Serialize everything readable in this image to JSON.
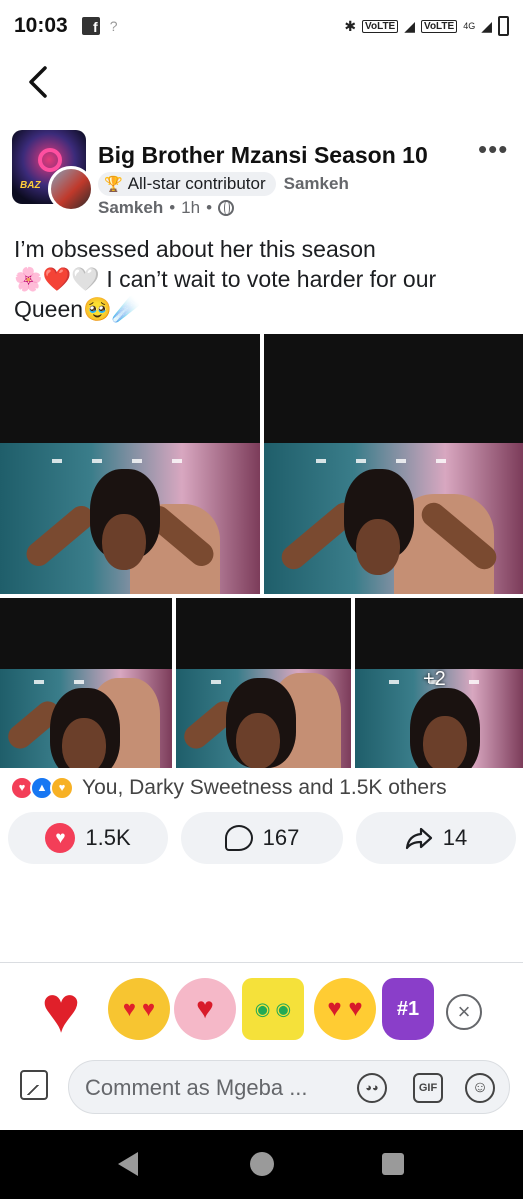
{
  "status_bar": {
    "time": "10:03",
    "fb_icon": "f",
    "signal_text": "?",
    "volte1": "VoLTE",
    "volte2": "VoLTE",
    "network": "4G"
  },
  "nav": {
    "back_icon": "‹"
  },
  "post": {
    "group_name": "Big Brother Mzansi Season 10",
    "badge_label": "All-star contributor",
    "badge_author": "Samkeh",
    "author": "Samkeh",
    "time_ago": "1h",
    "separator": "•",
    "more_icon": "•••",
    "text_line1": "I’m obsessed about her this season",
    "text_line2_emojis": "🌸❤️🤍",
    "text_line2": "I can’t wait to vote harder for our",
    "text_line3": "Queen",
    "text_line3_emojis": "🥹☄️",
    "more_photos": "+2"
  },
  "reactions": {
    "summary": "You, Darky Sweetness and 1.5K others"
  },
  "actions": {
    "reactions_count": "1.5K",
    "comments_count": "167",
    "shares_count": "14"
  },
  "stickers": {
    "heart": "♥",
    "cat": "♥ ♥",
    "girl": "♥",
    "sponge": "◉ ◉",
    "face": "♥ ♥",
    "finger": "#1",
    "close": "×"
  },
  "composer": {
    "placeholder": "Comment as Mgeba ...",
    "gif_label": "GIF",
    "emoji_label": "☺"
  }
}
